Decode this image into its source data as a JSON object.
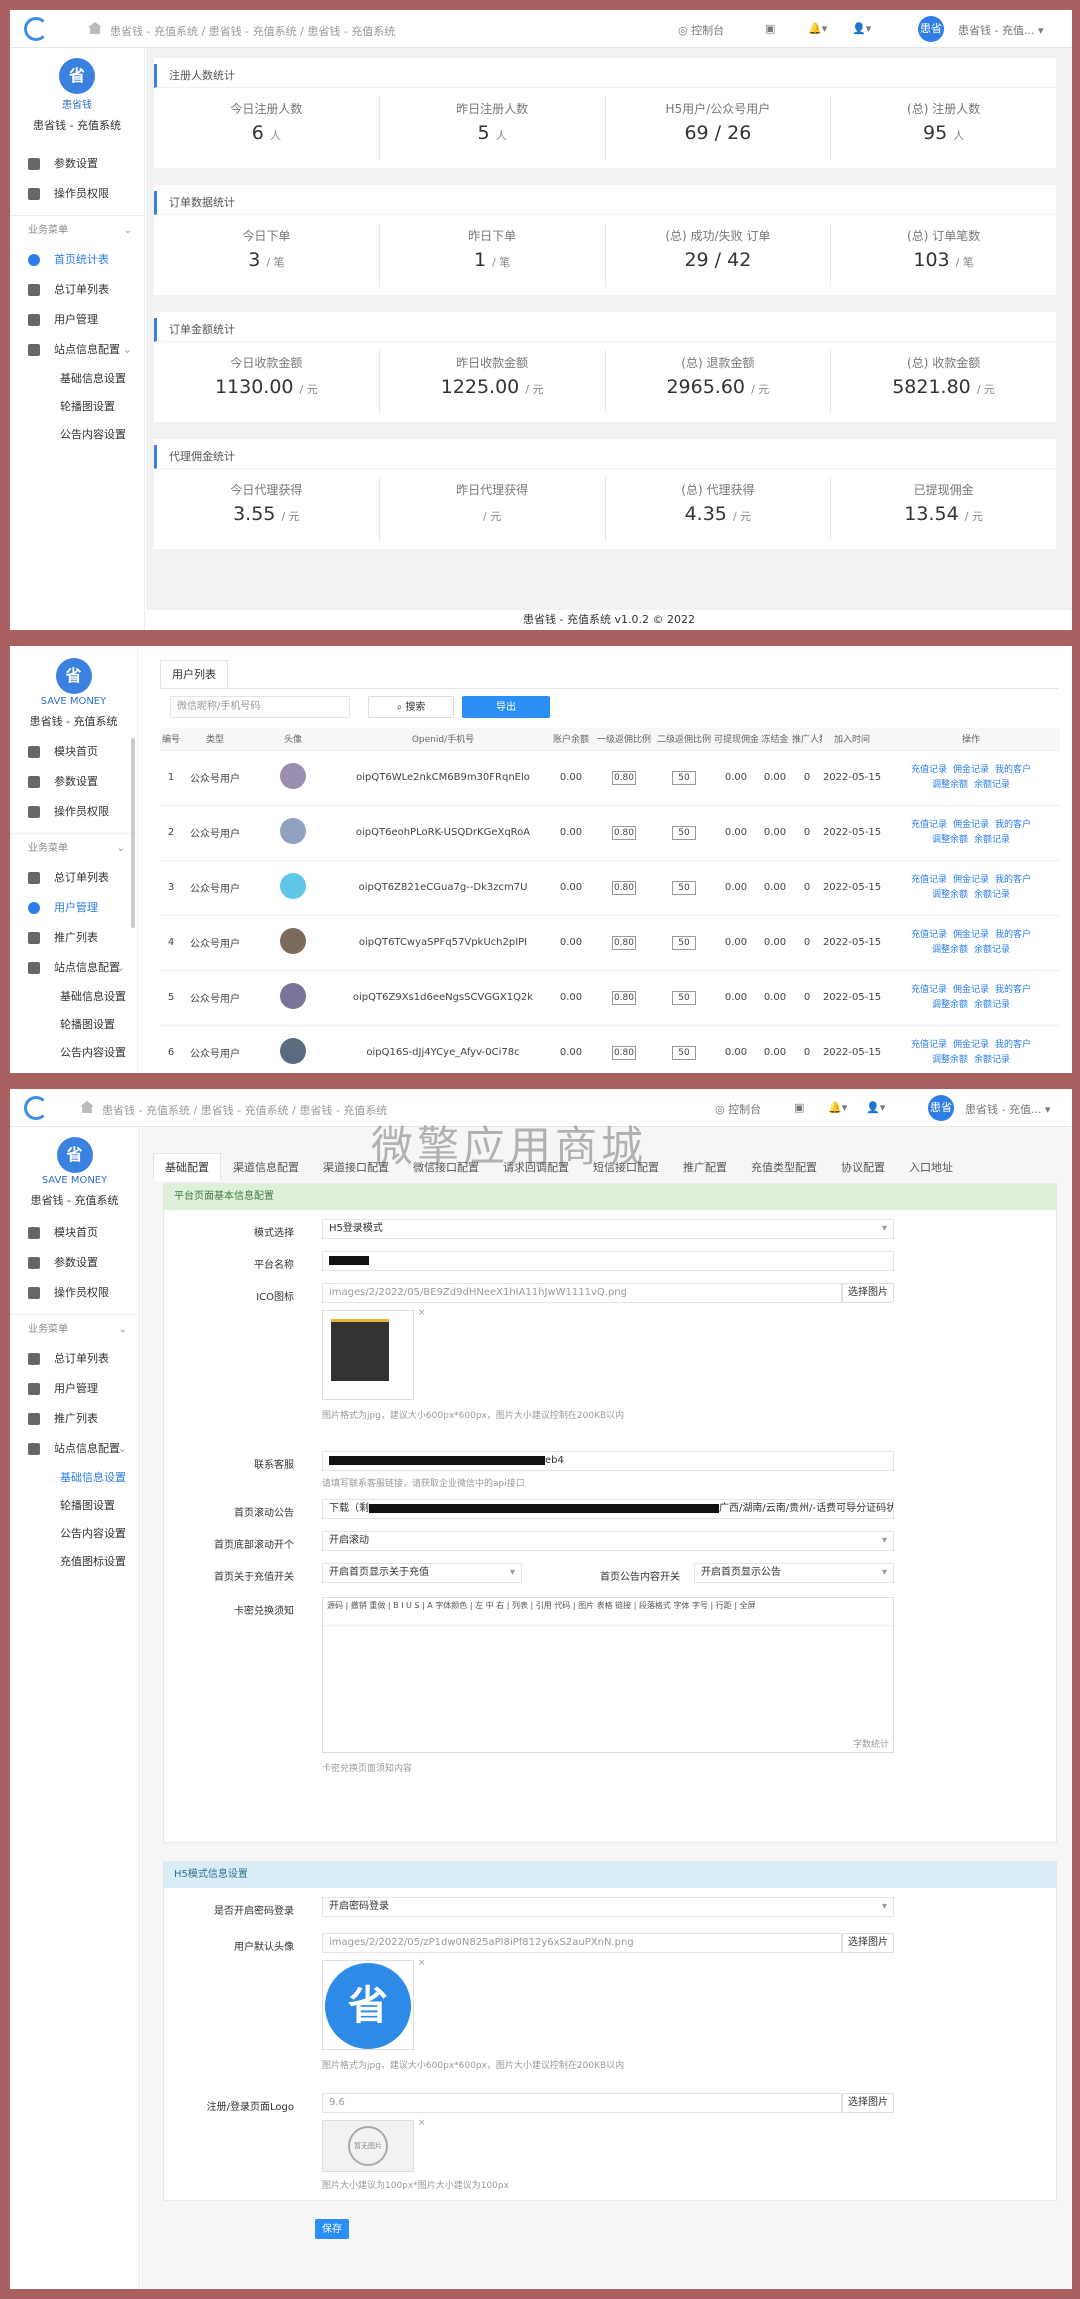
{
  "header": {
    "breadcrumb": [
      "患省钱 - 充值系统",
      "患省钱 - 充值系统",
      "患省钱 - 充值系统"
    ],
    "console": "控制台",
    "user": "患省钱 - 充值...",
    "avatar": "患省钱"
  },
  "sidebar": {
    "brand": "患省钱",
    "brand_en": "SAVE MONEY",
    "system": "患省钱 - 充值系统",
    "items": [
      "参数设置",
      "操作员权限",
      "业务菜单",
      "首页统计表",
      "总订单列表",
      "用户管理",
      "站点信息配置",
      "基础信息设置",
      "轮播图设置",
      "公告内容设置"
    ]
  },
  "sidebar2": {
    "items": [
      "模块首页",
      "参数设置",
      "操作员权限",
      "业务菜单",
      "总订单列表",
      "用户管理",
      "推广列表",
      "站点信息配置",
      "基础信息设置",
      "轮播图设置",
      "公告内容设置",
      "充值图标设置"
    ]
  },
  "dashboard": {
    "sections": [
      {
        "title": "注册人数统计",
        "stats": [
          {
            "label": "今日注册人数",
            "value": "6",
            "unit": "人"
          },
          {
            "label": "昨日注册人数",
            "value": "5",
            "unit": "人"
          },
          {
            "label": "H5用户/公众号用户",
            "value": "69 / 26",
            "unit": ""
          },
          {
            "label": "(总) 注册人数",
            "value": "95",
            "unit": "人"
          }
        ]
      },
      {
        "title": "订单数据统计",
        "stats": [
          {
            "label": "今日下单",
            "value": "3",
            "unit": "/ 笔"
          },
          {
            "label": "昨日下单",
            "value": "1",
            "unit": "/ 笔"
          },
          {
            "label": "(总) 成功/失败 订单",
            "value": "29 / 42",
            "unit": ""
          },
          {
            "label": "(总) 订单笔数",
            "value": "103",
            "unit": "/ 笔"
          }
        ]
      },
      {
        "title": "订单金额统计",
        "stats": [
          {
            "label": "今日收款金额",
            "value": "1130.00",
            "unit": "/ 元"
          },
          {
            "label": "昨日收款金额",
            "value": "1225.00",
            "unit": "/ 元"
          },
          {
            "label": "(总) 退款金额",
            "value": "2965.60",
            "unit": "/ 元"
          },
          {
            "label": "(总) 收款金额",
            "value": "5821.80",
            "unit": "/ 元"
          }
        ]
      },
      {
        "title": "代理佣金统计",
        "stats": [
          {
            "label": "今日代理获得",
            "value": "3.55",
            "unit": "/ 元"
          },
          {
            "label": "昨日代理获得",
            "value": "",
            "unit": "/ 元"
          },
          {
            "label": "(总) 代理获得",
            "value": "4.35",
            "unit": "/ 元"
          },
          {
            "label": "已提现佣金",
            "value": "13.54",
            "unit": "/ 元"
          }
        ]
      }
    ],
    "footer": "患省钱 - 充值系统 v1.0.2 © 2022"
  },
  "userlist": {
    "tab": "用户列表",
    "search_placeholder": "微信昵称/手机号码",
    "search_btn": "搜索",
    "export_btn": "导出",
    "columns": [
      "编号",
      "类型",
      "头像",
      "Openid/手机号",
      "账户余额",
      "一级返佣比例",
      "二级返佣比例",
      "可提现佣金",
      "冻结金",
      "推广人数",
      "加入时间",
      "操作"
    ],
    "rows": [
      {
        "id": "1",
        "type": "公众号用户",
        "name": "",
        "openid": "oipQT6WLe2nkCM6B9m30FRqnElo",
        "bal": "0.00",
        "r1": "0.80",
        "r2": "50",
        "w": "0.00",
        "f": "0.00",
        "p": "0",
        "date": "2022-05-15"
      },
      {
        "id": "2",
        "type": "公众号用户",
        "name": "",
        "openid": "oipQT6eohPLoRK-USQDrKGeXqRoA",
        "bal": "0.00",
        "r1": "0.80",
        "r2": "50",
        "w": "0.00",
        "f": "0.00",
        "p": "0",
        "date": "2022-05-15"
      },
      {
        "id": "3",
        "type": "公众号用户",
        "name": "",
        "openid": "oipQT6Z821eCGua7g--Dk3zcm7U",
        "bal": "0.00",
        "r1": "0.80",
        "r2": "50",
        "w": "0.00",
        "f": "0.00",
        "p": "0",
        "date": "2022-05-15"
      },
      {
        "id": "4",
        "type": "公众号用户",
        "name": "",
        "openid": "oipQT6TCwyaSPFq57VpkUch2pIPI",
        "bal": "0.00",
        "r1": "0.80",
        "r2": "50",
        "w": "0.00",
        "f": "0.00",
        "p": "0",
        "date": "2022-05-15"
      },
      {
        "id": "5",
        "type": "公众号用户",
        "name": "",
        "openid": "oipQT6Z9Xs1d6eeNgsSCVGGX1Q2k",
        "bal": "0.00",
        "r1": "0.80",
        "r2": "50",
        "w": "0.00",
        "f": "0.00",
        "p": "0",
        "date": "2022-05-15"
      },
      {
        "id": "6",
        "type": "公众号用户",
        "name": "",
        "openid": "oipQ16S-dJj4YCye_Afyv-0Ci78c",
        "bal": "0.00",
        "r1": "0.80",
        "r2": "50",
        "w": "0.00",
        "f": "0.00",
        "p": "0",
        "date": "2022-05-15"
      }
    ],
    "ops": [
      "充值记录",
      "佣金记录",
      "我的客户",
      "调整余额",
      "余额记录"
    ]
  },
  "config": {
    "watermark": "微擎应用商城",
    "tabs": [
      "基础配置",
      "渠道信息配置",
      "渠道接口配置",
      "微信接口配置",
      "请求回调配置",
      "短信接口配置",
      "推广配置",
      "充值类型配置",
      "协议配置",
      "入口地址"
    ],
    "sec1": "平台页面基本信息配置",
    "sec2": "H5模式信息设置",
    "fields": {
      "mode_label": "模式选择",
      "mode_value": "H5登录模式",
      "name_label": "平台名称",
      "ico_label": "ICO图标",
      "ico_value": "images/2/2022/05/BE9Zd9dHNeeX1hIA11hJwW1111vQ.png",
      "choose": "选择图片",
      "ico_hint": "图片格式为jpg，建议大小600px*600px，图片大小建议控制在200KB以内",
      "kefu_label": "联系客服",
      "kefu_tail": "eb4",
      "kefu_hint": "请填写联系客服链接，请获取企业微信中的api接口",
      "notice_label": "首页滚动公告",
      "notice_head": "下载（剩",
      "notice_tail": "广西/湖南/云南/贵州/-话费可导分证码状",
      "scroll_label": "首页底部滚动开个",
      "scroll_value": "开启滚动",
      "rc_label": "首页关于充值开关",
      "rc_value": "开启首页显示关于充值",
      "ann_label": "首页公告内容开关",
      "ann_value": "开启首页显示公告",
      "card_label": "卡密兑换须知",
      "card_hint": "卡密兑换页面须知内容",
      "editor_count": "字数统计",
      "pwd_label": "是否开启密码登录",
      "pwd_value": "开启密码登录",
      "avatar_label": "用户默认头像",
      "avatar_value": "images/2/2022/05/zP1dw0N825aPI8iPf812y6xS2auPXnN.png",
      "logo_label": "注册/登录页面Logo",
      "logo_value": "9.6",
      "logo_alt": "暂无图片",
      "logo_hint": "图片大小建议为100px*图片大小建议为100px",
      "save": "保存"
    },
    "editor_bar": "源码 | 撤销 重做 | B I U S | A 字体颜色 | 左 中 右 | 列表 | 引用 代码 | 图片 表格 链接 | 段落格式 字体 字号 | 行距 | 全屏"
  }
}
